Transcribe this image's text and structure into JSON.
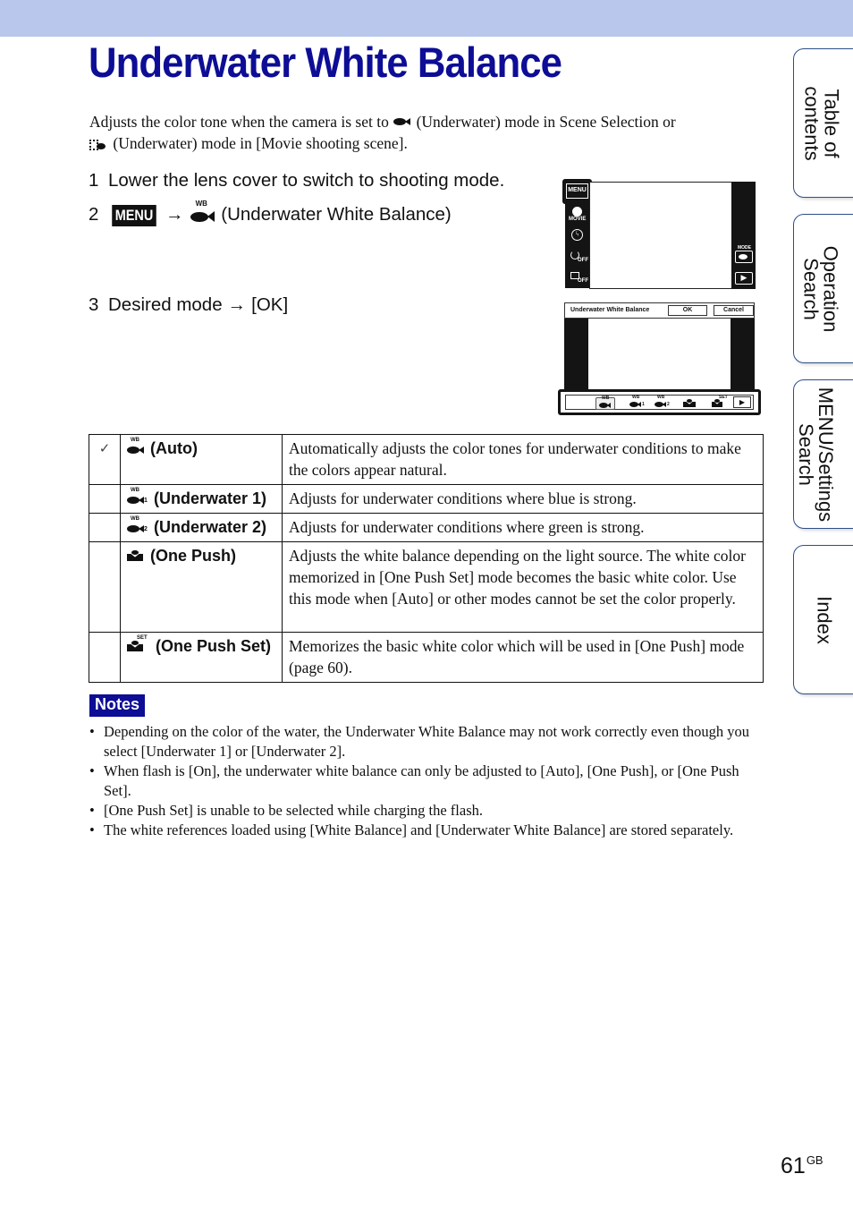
{
  "header": {
    "band_color": "#b8c7eb",
    "title": "Underwater White Balance",
    "title_color": "#0d0d96"
  },
  "intro": {
    "part1": "Adjusts the color tone when the camera is set to",
    "part2": "(Underwater) mode in Scene Selection or",
    "part3": "(Underwater) mode in [Movie shooting scene].",
    "icon1": "underwater-fish-icon",
    "icon2": "movie-underwater-icon"
  },
  "steps": [
    {
      "num": "1",
      "text": "Lower the lens cover to switch to shooting mode."
    },
    {
      "num": "2",
      "menu_key": "MENU",
      "arrow": "→",
      "text": "(Underwater White Balance)",
      "icon": "wb-fish-icon"
    },
    {
      "num": "3",
      "text": "Desired mode",
      "arrow": "→",
      "text2": "[OK]"
    }
  ],
  "camera_screen_1": {
    "menu_label": "MENU",
    "movie_label": "MOVIE",
    "flash_icon": "flash-auto-icon",
    "selftimer_label": "OFF",
    "burst_label": "OFF",
    "mode_label": "MODE",
    "mode_icon": "underwater-fish-icon",
    "play_icon": "play-icon"
  },
  "camera_screen_2": {
    "title": "Underwater White Balance",
    "ok_label": "OK",
    "cancel_label": "Cancel",
    "options": [
      "WB",
      "WB 1",
      "WB 2",
      "One Push",
      "SET"
    ],
    "selected_index": 0,
    "play_icon": "play-icon"
  },
  "modes_table": {
    "rows": [
      {
        "default": true,
        "check": "✓",
        "icon": "wb-auto-icon",
        "sub": "",
        "name": "(Auto)",
        "desc": "Automatically adjusts the color tones for underwater conditions to make the colors appear natural."
      },
      {
        "default": false,
        "check": "",
        "icon": "wb-underwater1-icon",
        "sub": "1",
        "name": "(Underwater 1)",
        "desc": "Adjusts for underwater conditions where blue is strong."
      },
      {
        "default": false,
        "check": "",
        "icon": "wb-underwater2-icon",
        "sub": "2",
        "name": "(Underwater 2)",
        "desc": "Adjusts for underwater conditions where green is strong."
      },
      {
        "default": false,
        "check": "",
        "icon": "one-push-icon",
        "sub": "",
        "name": "(One Push)",
        "desc": "Adjusts the white balance depending on the light source. The white color memorized in [One Push Set] mode becomes the basic white color. Use this mode when [Auto] or other modes cannot be set the color properly."
      },
      {
        "default": false,
        "check": "",
        "icon": "one-push-set-icon",
        "sub": "SET",
        "name": "(One Push Set)",
        "desc": "Memorizes the basic white color which will be used in [One Push] mode (page 60)."
      }
    ]
  },
  "notes": {
    "label": "Notes",
    "items": [
      "Depending on the color of the water, the Underwater White Balance may not work correctly even though you select [Underwater 1] or [Underwater 2].",
      "When flash is [On], the underwater white balance can only be adjusted to [Auto], [One Push], or [One Push Set].",
      "[One Push Set] is unable to be selected while charging the flash.",
      "The white references loaded using [White Balance] and [Underwater White Balance] are stored separately."
    ]
  },
  "side_tabs": [
    {
      "line1": "Table of",
      "line2": "contents"
    },
    {
      "line1": "Operation",
      "line2": "Search"
    },
    {
      "line1": "MENU/Settings",
      "line2": "Search"
    },
    {
      "line1": "Index",
      "line2": ""
    }
  ],
  "footer": {
    "page_number": "61",
    "suffix": "GB"
  }
}
